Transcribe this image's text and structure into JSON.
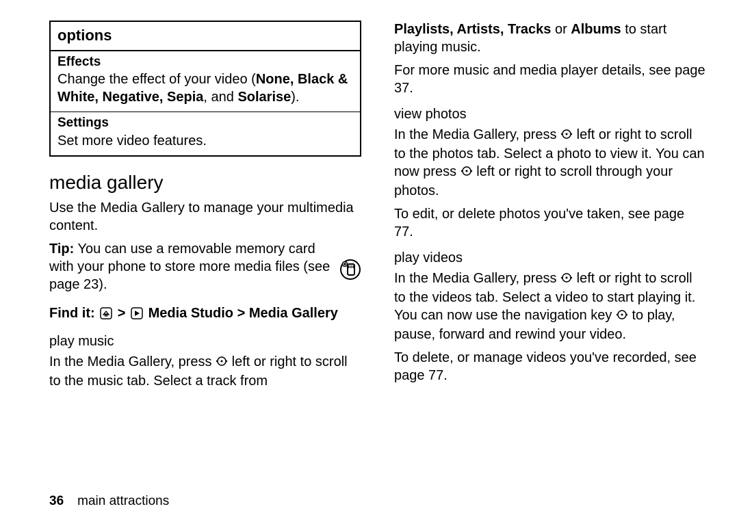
{
  "options": {
    "header": "options",
    "row1": {
      "title": "Effects",
      "text_before": "Change the effect of your video (",
      "bold_list": "None, Black & White, Negative, Sepia",
      "text_mid": ", and ",
      "bold_last": "Solarise",
      "text_after": ")."
    },
    "row2": {
      "title": "Settings",
      "text": "Set more video features."
    }
  },
  "media_gallery": {
    "heading": "media gallery",
    "intro": "Use the Media Gallery to manage your multimedia content.",
    "tip_label": "Tip:",
    "tip_text": " You can use a removable memory card with your phone to store more media files (see page 23).",
    "findit_label": "Find it: ",
    "findit_path1": "Media Studio",
    "findit_gt": " > ",
    "findit_path2": "Media Gallery"
  },
  "play_music": {
    "heading": "play music",
    "p1a": "In the Media Gallery, press ",
    "p1b": " left or right to scroll to the music tab. Select a track from ",
    "p2_bold": "Playlists, Artists, Tracks",
    "p2_mid": " or ",
    "p2_bold2": "Albums",
    "p2_end": " to start playing music.",
    "p3": "For more music and media player details, see page 37."
  },
  "view_photos": {
    "heading": "view photos",
    "p1a": "In the Media Gallery, press ",
    "p1b": " left or right to scroll to the photos tab. Select a photo to view it. You can now press ",
    "p1c": " left or right to scroll through your photos.",
    "p2": "To edit, or delete photos you've taken, see page 77."
  },
  "play_videos": {
    "heading": "play videos",
    "p1a": "In the Media Gallery, press ",
    "p1b": " left or right to scroll to the videos tab. Select a video to start playing it. You can now use the navigation key ",
    "p1c": " to play, pause, forward and rewind your video.",
    "p2": "To delete, or manage videos you've recorded, see page 77."
  },
  "footer": {
    "page": "36",
    "section": "main attractions"
  }
}
